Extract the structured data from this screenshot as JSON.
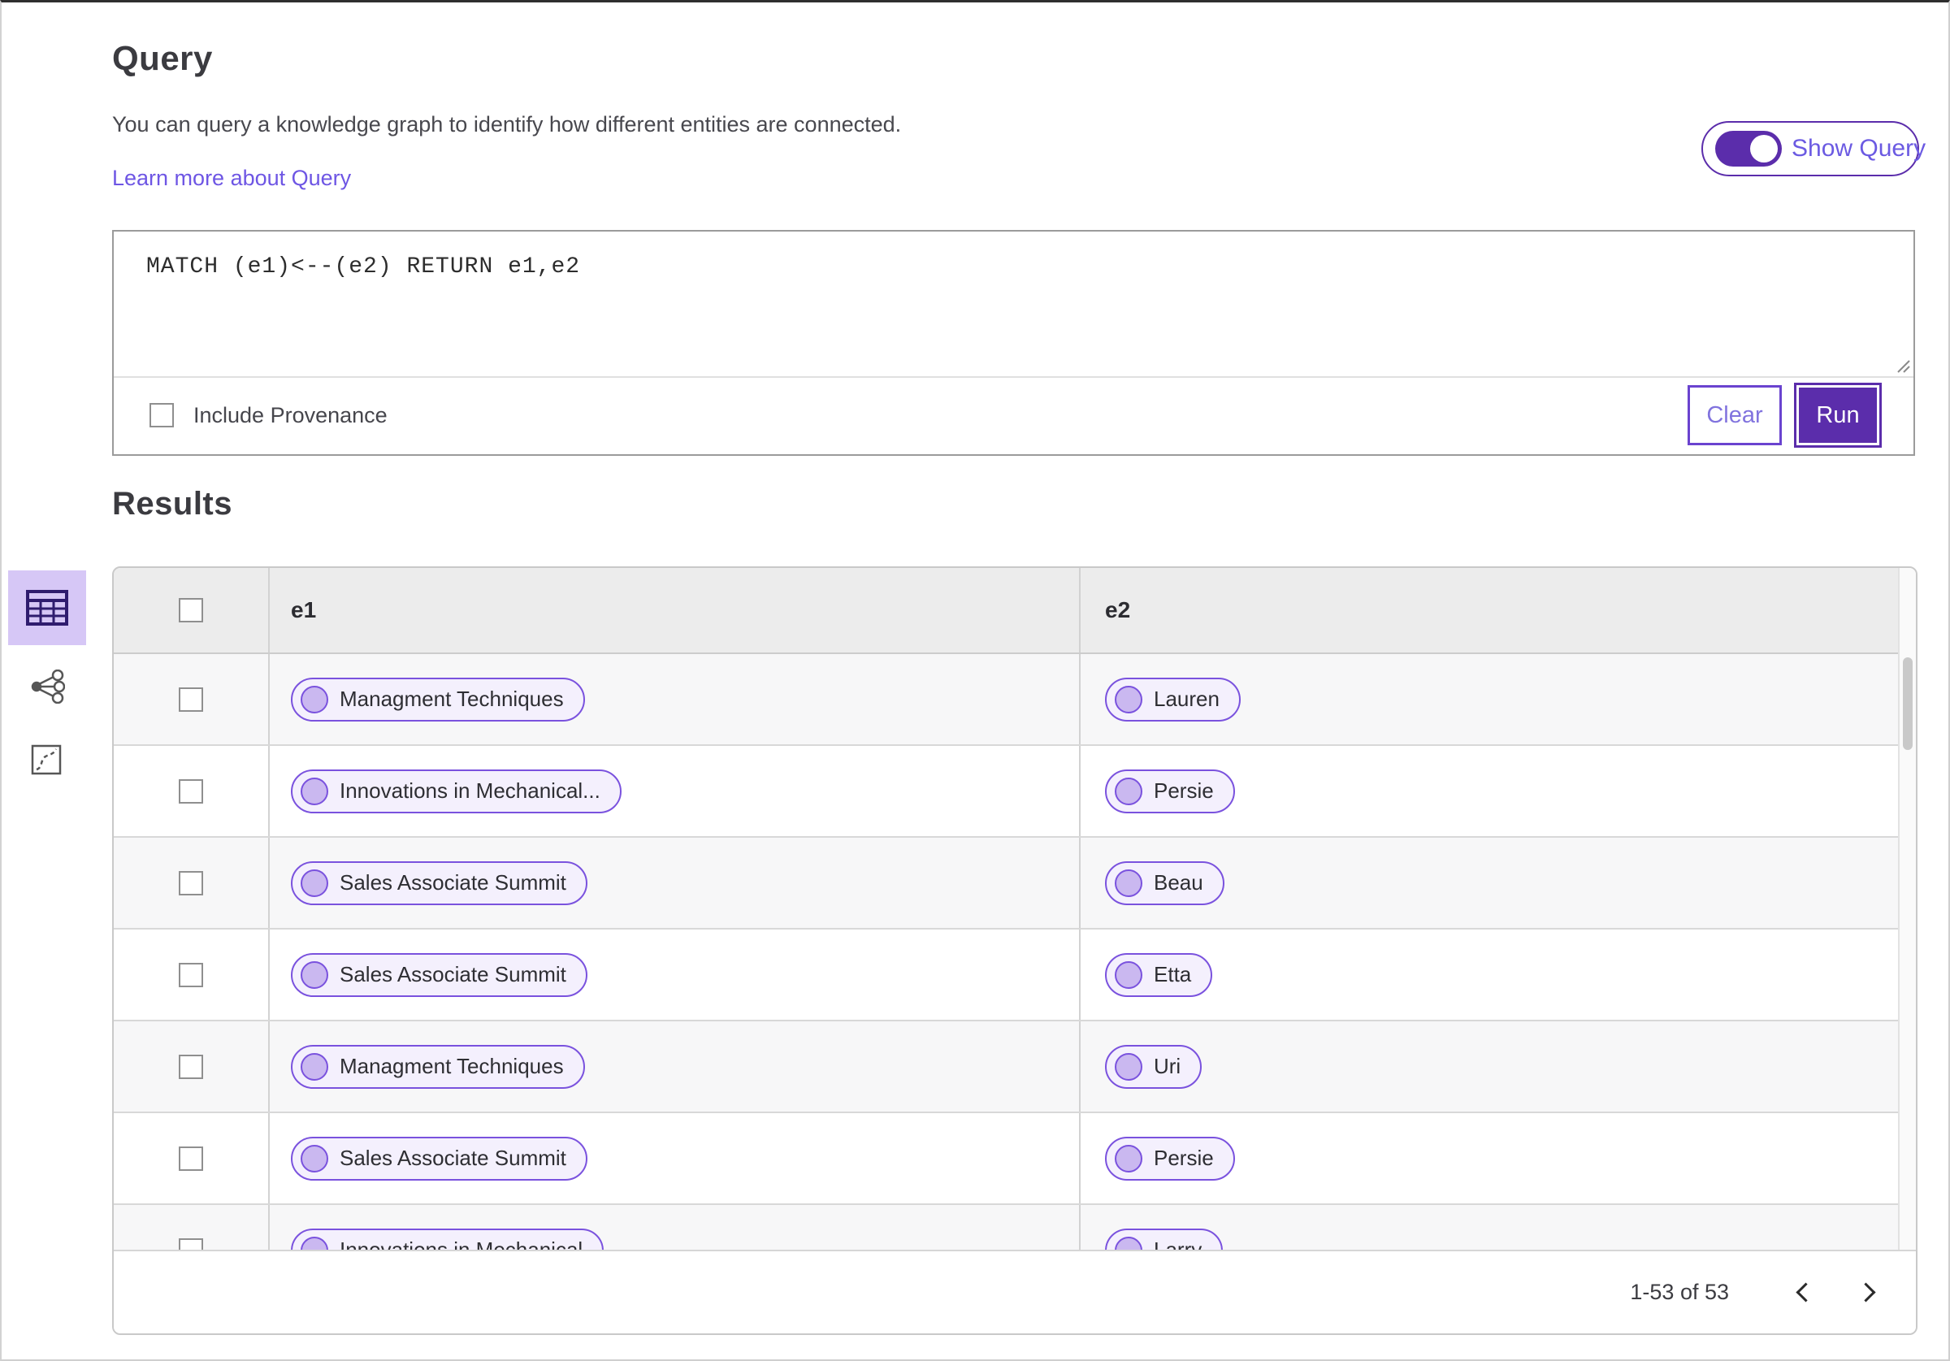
{
  "colors": {
    "accent_purple": "#5b2dab",
    "link_purple": "#6e56e4",
    "toggle_label_purple": "#6b5ae2",
    "pill_border": "#7a52de",
    "pill_bg": "#f4f0fd",
    "pill_dot": "#cab8f0",
    "selected_view_bg": "#d6c7f6",
    "table_header_bg": "#ececec",
    "row_alt_bg": "#f7f7f8"
  },
  "query": {
    "title": "Query",
    "description": "You can query a knowledge graph to identify how different entities are connected.",
    "learn_more_link": "Learn more about Query",
    "show_query_label": "Show Query",
    "editor_text": "MATCH (e1)<--(e2) RETURN e1,e2",
    "include_provenance_label": "Include Provenance",
    "clear_button": "Clear",
    "run_button": "Run"
  },
  "results": {
    "title": "Results",
    "columns": [
      "e1",
      "e2"
    ],
    "rows": [
      {
        "e1": "Managment Techniques",
        "e2": "Lauren"
      },
      {
        "e1": "Innovations in Mechanical...",
        "e2": "Persie"
      },
      {
        "e1": "Sales Associate Summit",
        "e2": "Beau"
      },
      {
        "e1": "Sales Associate Summit",
        "e2": "Etta"
      },
      {
        "e1": "Managment Techniques",
        "e2": "Uri"
      },
      {
        "e1": "Sales Associate Summit",
        "e2": "Persie"
      },
      {
        "e1": "Innovations in Mechanical",
        "e2": "Larry"
      }
    ],
    "pagination": {
      "range_text": "1-53 of 53"
    }
  }
}
